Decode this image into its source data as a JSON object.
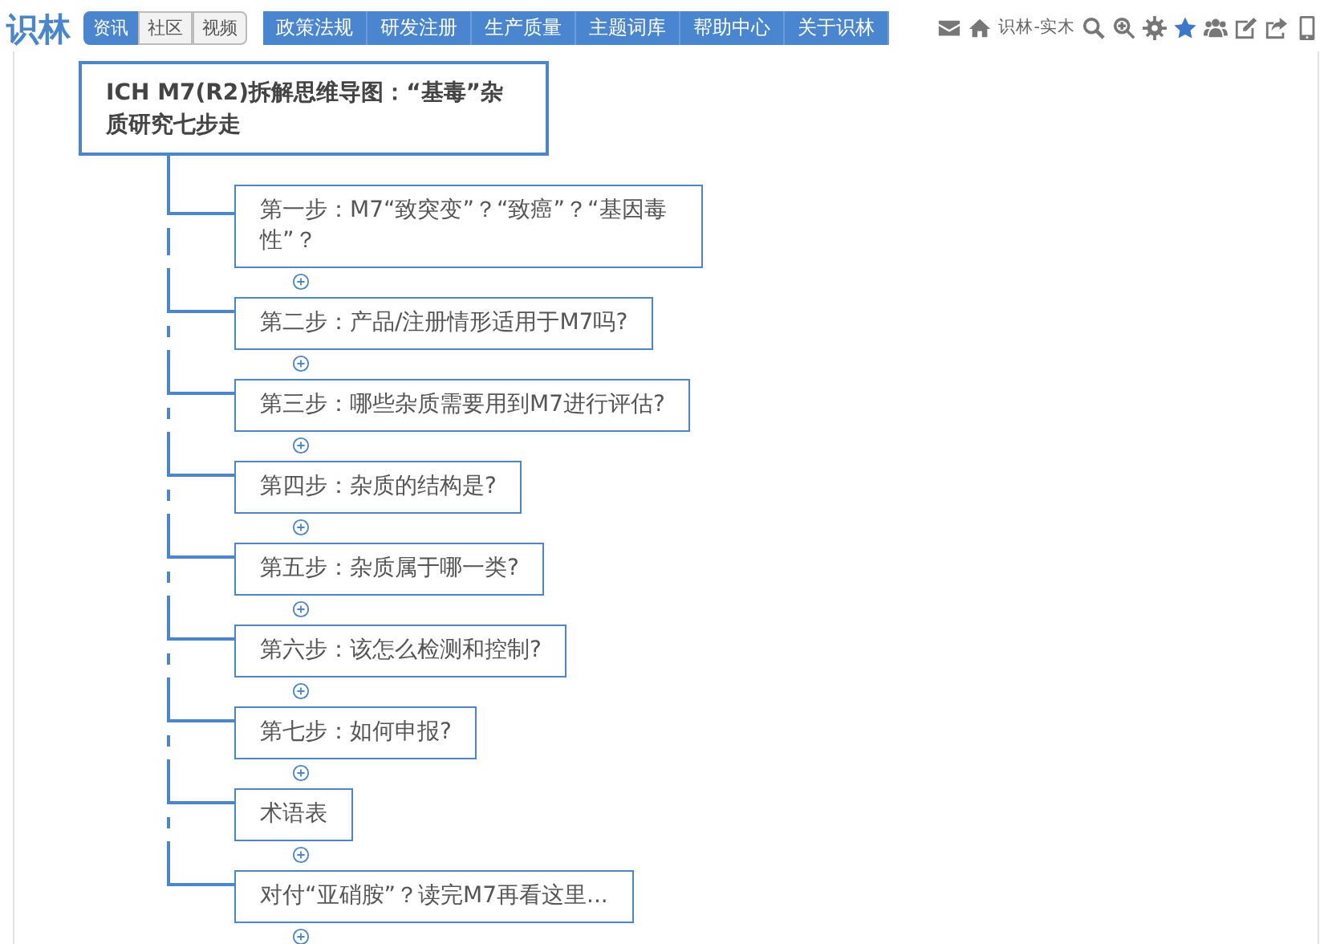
{
  "header": {
    "logo": "识林",
    "sections": [
      {
        "label": "资讯",
        "selected": true
      },
      {
        "label": "社区",
        "selected": false
      },
      {
        "label": "视频",
        "selected": false
      }
    ],
    "menu": [
      "政策法规",
      "研发注册",
      "生产质量",
      "主题词库",
      "帮助中心",
      "关于识林"
    ],
    "user_label": "识林-实木"
  },
  "mindmap": {
    "root": "ICH M7(R2)拆解思维导图：“基毒”杂质研究七步走",
    "branches": [
      {
        "label": "第一步：M7“致突变”？“致癌”？“基因毒性”？"
      },
      {
        "label": "第二步：产品/注册情形适用于M7吗?"
      },
      {
        "label": "第三步：哪些杂质需要用到M7进行评估?"
      },
      {
        "label": "第四步：杂质的结构是?"
      },
      {
        "label": "第五步：杂质属于哪一类?"
      },
      {
        "label": "第六步：该怎么检测和控制?"
      },
      {
        "label": "第七步：如何申报?"
      },
      {
        "label": "术语表"
      },
      {
        "label": "对付“亚硝胺”？读完M7再看这里..."
      }
    ]
  }
}
